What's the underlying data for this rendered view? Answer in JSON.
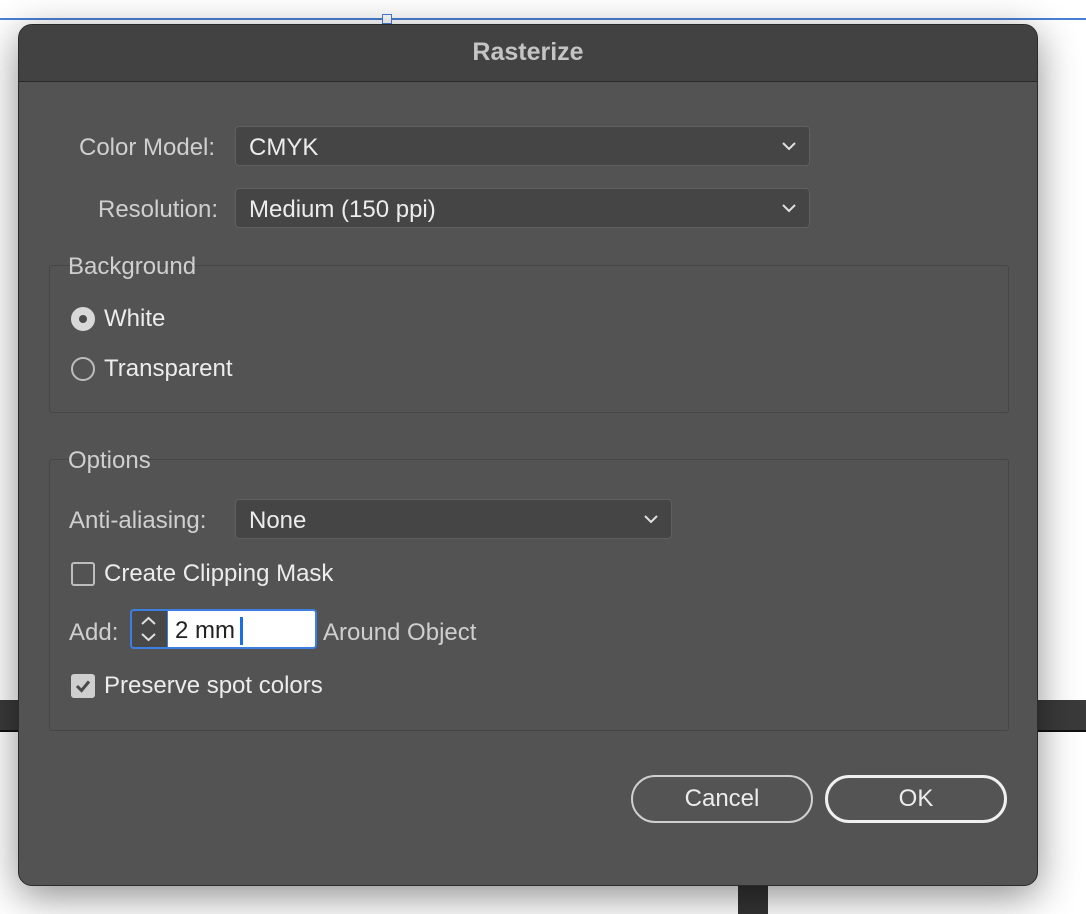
{
  "dialog": {
    "title": "Rasterize",
    "color_model": {
      "label": "Color Model:",
      "value": "CMYK"
    },
    "resolution": {
      "label": "Resolution:",
      "value": "Medium (150 ppi)"
    },
    "background": {
      "title": "Background",
      "options": [
        {
          "label": "White",
          "selected": true
        },
        {
          "label": "Transparent",
          "selected": false
        }
      ]
    },
    "options": {
      "title": "Options",
      "anti_aliasing": {
        "label": "Anti-aliasing:",
        "value": "None"
      },
      "clipping_mask": {
        "label": "Create Clipping Mask",
        "checked": false
      },
      "add": {
        "label": "Add:",
        "value": "2 mm",
        "suffix": "Around Object"
      },
      "spot_colors": {
        "label": "Preserve spot colors",
        "checked": true
      }
    },
    "buttons": {
      "cancel": "Cancel",
      "ok": "OK"
    }
  },
  "colors": {
    "dialog_bg": "#535353",
    "titlebar_bg": "#424242",
    "focus_ring": "#3d7fe0"
  }
}
